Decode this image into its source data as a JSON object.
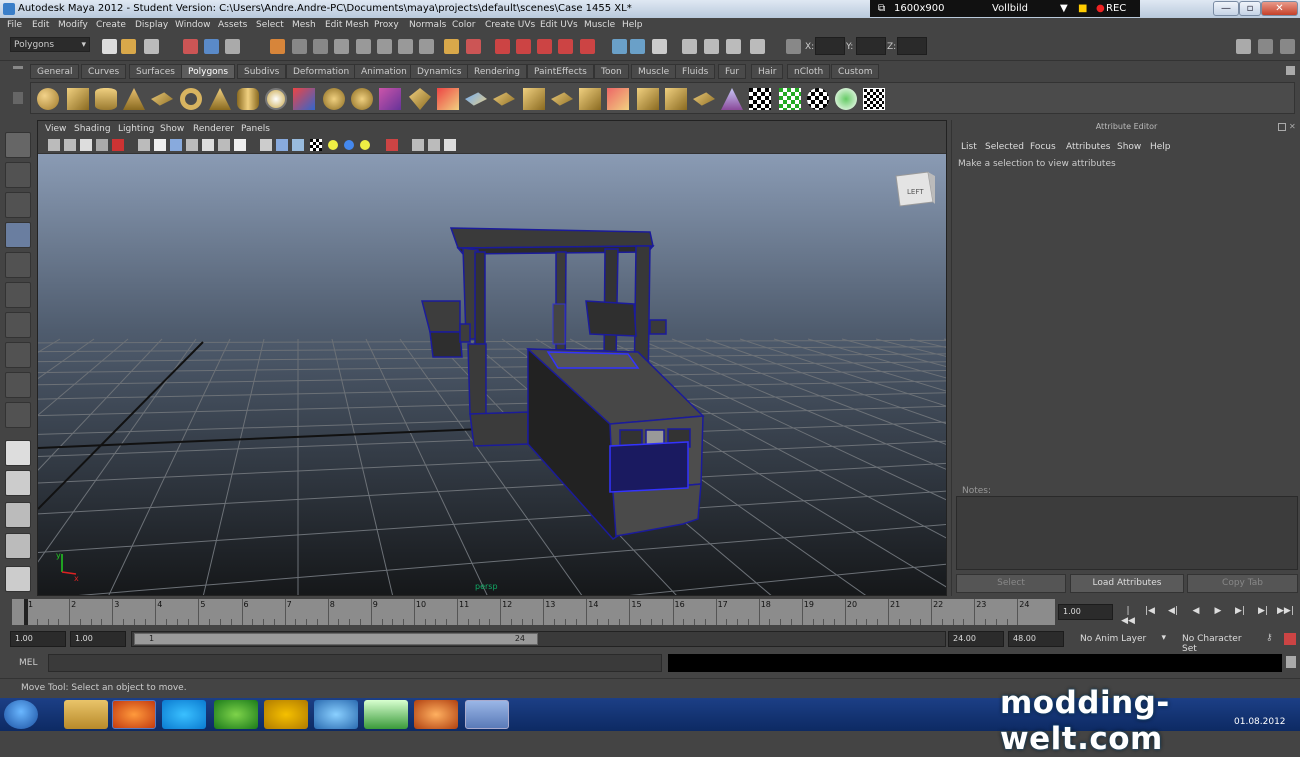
{
  "window": {
    "title": "Autodesk Maya 2012 - Student Version: C:\\Users\\Andre.Andre-PC\\Documents\\maya\\projects\\default\\scenes\\Case 1455 XL*",
    "recorder": {
      "resolution": "1600x900",
      "mode": "Vollbild",
      "rec": "REC"
    },
    "controls": {
      "minimize": "—",
      "restore": "▫",
      "close": "✕"
    }
  },
  "menubar": [
    "File",
    "Edit",
    "Modify",
    "Create",
    "Display",
    "Window",
    "Assets",
    "Select",
    "Mesh",
    "Edit Mesh",
    "Proxy",
    "Normals",
    "Color",
    "Create UVs",
    "Edit UVs",
    "Muscle",
    "Help"
  ],
  "statusline": {
    "menuset": "Polygons",
    "x_label": "X:",
    "y_label": "Y:",
    "z_label": "Z:"
  },
  "shelf": {
    "tabs": [
      "General",
      "Curves",
      "Surfaces",
      "Polygons",
      "Subdivs",
      "Deformation",
      "Animation",
      "Dynamics",
      "Rendering",
      "PaintEffects",
      "Toon",
      "Muscle",
      "Fluids",
      "Fur",
      "Hair",
      "nCloth",
      "Custom"
    ],
    "active_tab": "Polygons"
  },
  "viewport": {
    "menu": [
      "View",
      "Shading",
      "Lighting",
      "Show",
      "Renderer",
      "Panels"
    ],
    "view_cube": "LEFT",
    "camera_label": "persp",
    "axis_y": "y",
    "axis_x": "x"
  },
  "attribute_editor": {
    "title": "Attribute Editor",
    "menu": [
      "List",
      "Selected",
      "Focus",
      "Attributes",
      "Show",
      "Help"
    ],
    "message": "Make a selection to view attributes",
    "notes_label": "Notes:",
    "buttons": {
      "select": "Select",
      "load": "Load Attributes",
      "copy": "Copy Tab"
    }
  },
  "timeline": {
    "frames": [
      "1",
      "2",
      "3",
      "4",
      "5",
      "6",
      "7",
      "8",
      "9",
      "10",
      "11",
      "12",
      "13",
      "14",
      "15",
      "16",
      "17",
      "18",
      "19",
      "20",
      "21",
      "22",
      "23",
      "24"
    ],
    "current_frame": "1.00",
    "playback_buttons": [
      "|◀◀",
      "|◀",
      "◀|",
      "◀",
      "▶",
      "▶|",
      "▶|",
      "▶▶|"
    ]
  },
  "range": {
    "start": "1.00",
    "playback_start": "1.00",
    "slider_start": "1",
    "slider_end": "24",
    "playback_end": "24.00",
    "end": "48.00",
    "anim_layer": "No Anim Layer",
    "char_set": "No Character Set"
  },
  "command": {
    "lang": "MEL"
  },
  "helpline": "Move Tool: Select an object to move.",
  "taskbar": {
    "date": "01.08.2012",
    "watermark": "modding-welt.com"
  }
}
